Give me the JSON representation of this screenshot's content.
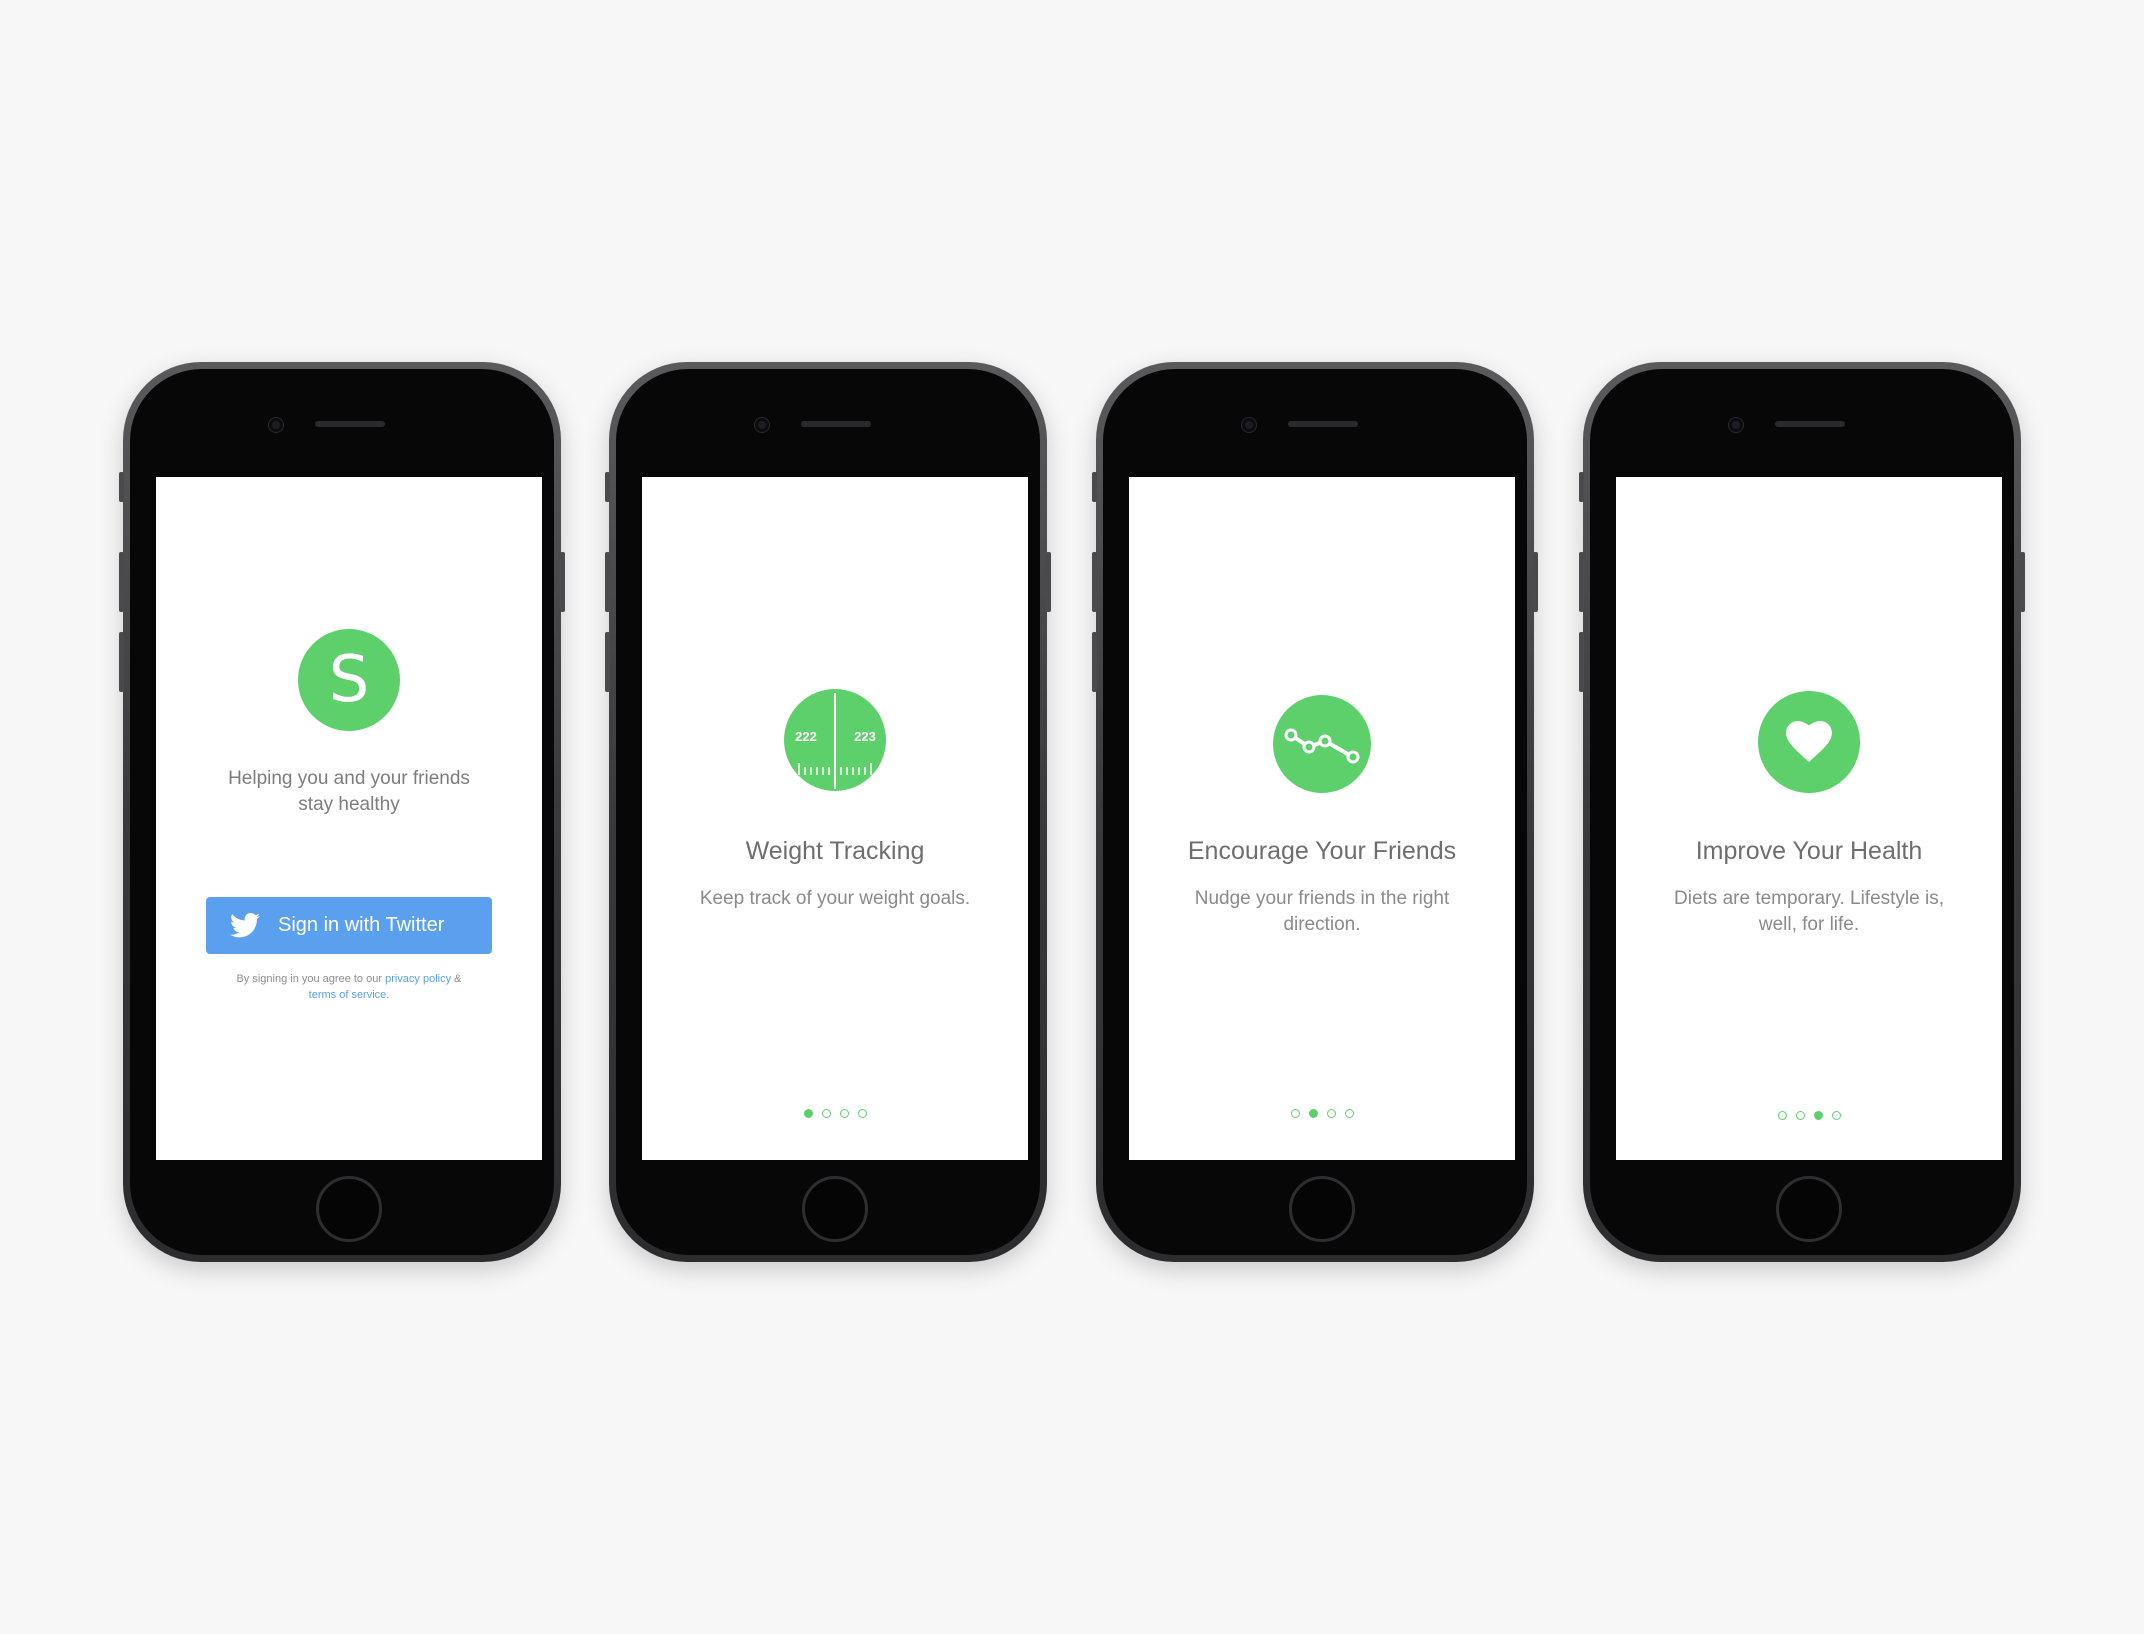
{
  "colors": {
    "accent": "#5dd06c",
    "twitter_blue": "#5aa0ee",
    "background": "#f7f7f7"
  },
  "screens": [
    {
      "logo_letter": "S",
      "tagline_line1": "Helping you and your friends",
      "tagline_line2": "stay healthy",
      "signin_label": "Sign in with Twitter",
      "signin_icon": "twitter-bird-icon",
      "legal_prefix": "By signing in you agree to our",
      "privacy_link": "privacy policy",
      "amp": "&",
      "terms_link": "terms of service."
    },
    {
      "icon": "weight-scale-icon",
      "scale_left": "222",
      "scale_right": "223",
      "title": "Weight Tracking",
      "description": "Keep track of your weight goals.",
      "active_page": 1,
      "page_count": 4
    },
    {
      "icon": "trend-line-icon",
      "title": "Encourage Your Friends",
      "description": "Nudge your friends in the right direction.",
      "active_page": 2,
      "page_count": 4
    },
    {
      "icon": "heart-icon",
      "title": "Improve Your Health",
      "description": "Diets are temporary. Lifestyle is, well, for life.",
      "active_page": 3,
      "page_count": 4
    }
  ]
}
